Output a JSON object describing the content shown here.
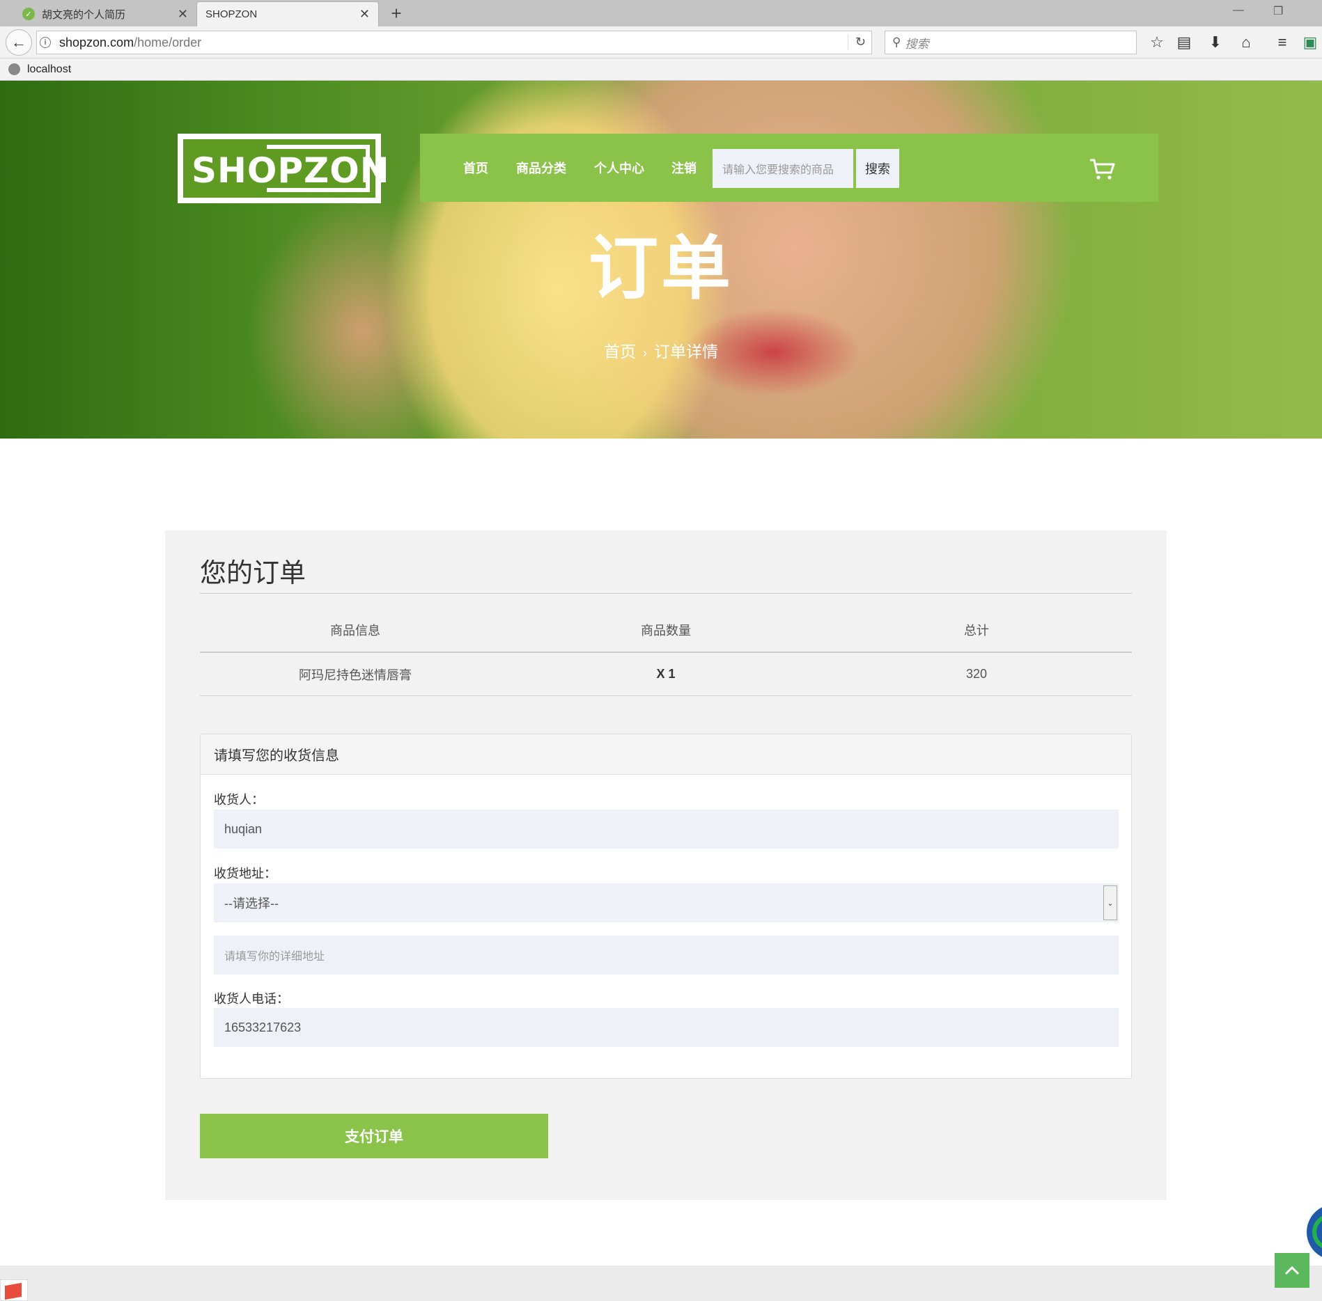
{
  "browser": {
    "tabs": [
      {
        "title": "胡文亮的个人简历",
        "active": false
      },
      {
        "title": "SHOPZON",
        "active": true
      }
    ],
    "url_host": "shopzon.com",
    "url_path": "/home/order",
    "search_placeholder": "搜索",
    "bookmark": "localhost"
  },
  "site": {
    "logo": "SHOPZON",
    "nav": [
      "首页",
      "商品分类",
      "个人中心",
      "注销"
    ],
    "search_placeholder": "请输入您要搜索的商品",
    "search_button": "搜索",
    "brand_color": "#8bc34a"
  },
  "hero": {
    "title": "订单",
    "breadcrumb": [
      "首页",
      "订单详情"
    ]
  },
  "order": {
    "heading": "您的订单",
    "columns": [
      "商品信息",
      "商品数量",
      "总计"
    ],
    "rows": [
      {
        "name": "阿玛尼持色迷情唇膏",
        "qty": "X 1",
        "total": "320"
      }
    ]
  },
  "shipping": {
    "card_title": "请填写您的收货信息",
    "receiver_label": "收货人：",
    "receiver_value": "huqian",
    "address_label": "收货地址：",
    "address_select": "--请选择--",
    "address_detail_placeholder": "请填写你的详细地址",
    "phone_label": "收货人电话：",
    "phone_value": "16533217623"
  },
  "pay_button": "支付订单"
}
